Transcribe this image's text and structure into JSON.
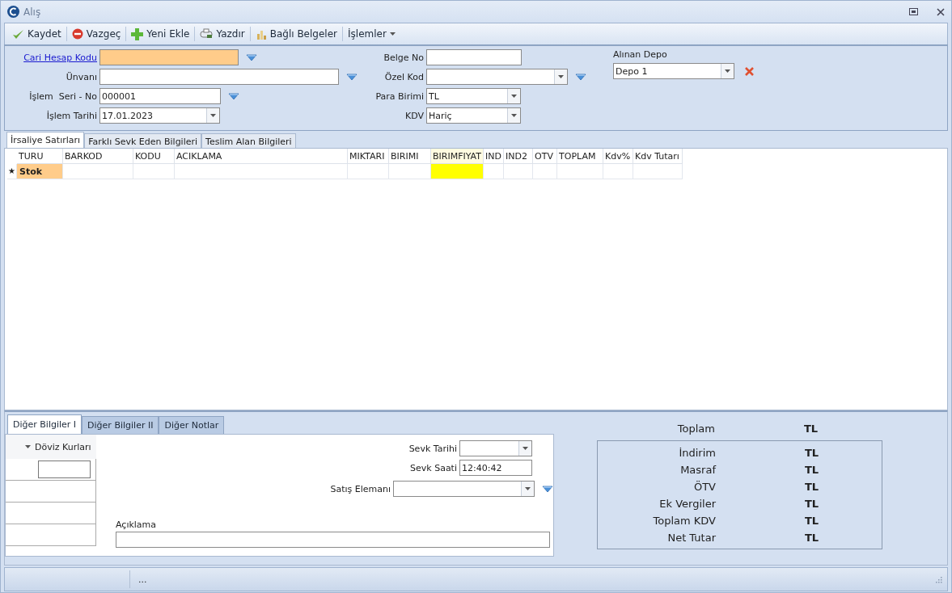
{
  "window": {
    "title": "Alış"
  },
  "toolbar": [
    {
      "label": "Kaydet",
      "kind": "check"
    },
    {
      "label": "Vazgeç",
      "kind": "cancel"
    },
    {
      "label": "Yeni Ekle",
      "kind": "add"
    },
    {
      "label": "Yazdır",
      "kind": "print"
    },
    {
      "label": "Bağlı Belgeler",
      "kind": "docs"
    },
    {
      "label": "İşlemler",
      "kind": "menu"
    }
  ],
  "header_left": [
    {
      "label": "Cari Hesap Kodu",
      "link": true,
      "kind": "text",
      "highlighted": true,
      "lookup": true
    },
    {
      "label": "Ünvanı",
      "link": false,
      "kind": "text",
      "highlighted": false,
      "lookup": true
    },
    {
      "label": "İşlem  Seri - No",
      "link": false,
      "kind": "text",
      "value": "000001",
      "highlighted": false,
      "lookup": true
    },
    {
      "label": "İşlem Tarihi",
      "link": false,
      "kind": "combo",
      "value": "17.01.2023",
      "highlighted": false,
      "lookup": false
    }
  ],
  "header_middle": [
    {
      "label": "Belge No",
      "kind": "text",
      "lookup": false
    },
    {
      "label": "Özel Kod",
      "kind": "combo",
      "lookup": true
    },
    {
      "label": "Para Birimi",
      "kind": "combo",
      "value": "TL",
      "lookup": false
    },
    {
      "label": "KDV",
      "kind": "combo",
      "value": "Hariç",
      "lookup": false
    }
  ],
  "depot": {
    "label": "Alınan Depo",
    "value": "Depo 1"
  },
  "grid_tabs": [
    {
      "label": "İrsaliye Satırları",
      "selected": true
    },
    {
      "label": "Farklı Sevk Eden Bilgileri",
      "selected": false
    },
    {
      "label": "Teslim Alan Bilgileri",
      "selected": false
    }
  ],
  "grid": {
    "columns": [
      {
        "label": "TURU",
        "highlight": false
      },
      {
        "label": "BARKOD",
        "highlight": false
      },
      {
        "label": "KODU",
        "highlight": false
      },
      {
        "label": "ACIKLAMA",
        "highlight": false
      },
      {
        "label": "MIKTARI",
        "highlight": false
      },
      {
        "label": "BIRIMI",
        "highlight": false
      },
      {
        "label": "BIRIMFIYAT",
        "highlight": true
      },
      {
        "label": "IND",
        "highlight": false
      },
      {
        "label": "IND2",
        "highlight": false
      },
      {
        "label": "OTV",
        "highlight": false
      },
      {
        "label": "TOPLAM",
        "highlight": false
      },
      {
        "label": "Kdv%",
        "highlight": false
      },
      {
        "label": "Kdv Tutarı",
        "highlight": false
      }
    ],
    "rows": [
      {
        "marker": "★",
        "type": "Stok"
      }
    ]
  },
  "bottom_tabs": [
    {
      "label": "Diğer Bilgiler I",
      "selected": true
    },
    {
      "label": "Diğer Bilgiler II",
      "selected": false
    },
    {
      "label": "Diğer Notlar",
      "selected": false
    }
  ],
  "exchange_rates": {
    "title": "Döviz Kurları"
  },
  "shipping": [
    {
      "label": "Sevk Tarihi",
      "kind": "combo",
      "lookup": false
    },
    {
      "label": "Sevk Saati",
      "kind": "text",
      "value": "12:40:42",
      "lookup": false
    },
    {
      "label": "Satış Elemanı",
      "kind": "combo",
      "lookup": true
    }
  ],
  "note": {
    "label": "Açıklama"
  },
  "totals": {
    "main": {
      "label": "Toplam",
      "currency": "TL"
    },
    "rows": [
      {
        "label": "İndirim",
        "currency": "TL"
      },
      {
        "label": "Masraf",
        "currency": "TL"
      },
      {
        "label": "ÖTV",
        "currency": "TL"
      },
      {
        "label": "Ek Vergiler",
        "currency": "TL"
      },
      {
        "label": "Toplam KDV",
        "currency": "TL"
      },
      {
        "label": "Net Tutar",
        "currency": "TL"
      }
    ]
  },
  "status_bar": {
    "text": "..."
  }
}
